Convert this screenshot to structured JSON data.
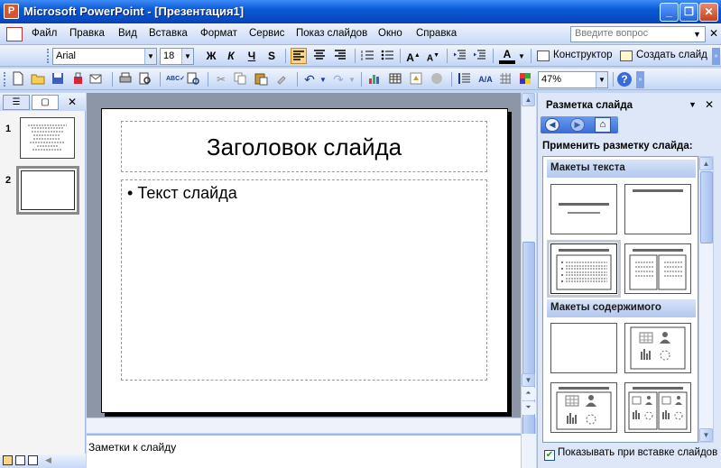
{
  "window": {
    "title": "Microsoft PowerPoint - [Презентация1]",
    "app_icon_letter": "P",
    "controls": {
      "minimize": "_",
      "restore": "❐",
      "close": "✕"
    }
  },
  "menu": {
    "items": [
      "Файл",
      "Правка",
      "Вид",
      "Вставка",
      "Формат",
      "Сервис",
      "Показ слайдов",
      "Окно",
      "Справка"
    ],
    "ask_placeholder": "Введите вопрос"
  },
  "formatting_toolbar": {
    "font": "Arial",
    "size": "18",
    "bold": "Ж",
    "italic": "К",
    "underline": "Ч",
    "shadow": "S",
    "font_color_letter": "A",
    "designer_label": "Конструктор",
    "new_slide_label": "Создать слайд"
  },
  "standard_toolbar": {
    "zoom": "47%",
    "help_icon": "?"
  },
  "outline_pane": {
    "tab_outline_icon": "outline-icon",
    "tab_slides_icon": "slides-icon",
    "close": "✕",
    "thumbnails": [
      {
        "number": "1"
      },
      {
        "number": "2"
      }
    ]
  },
  "slide": {
    "title": "Заголовок слайда",
    "body_bullet": "•",
    "body_text": "Текст слайда"
  },
  "notes": {
    "placeholder": "Заметки к слайду"
  },
  "task_pane": {
    "title": "Разметка слайда",
    "apply_label": "Применить разметку слайда:",
    "sections": [
      "Макеты текста",
      "Макеты содержимого"
    ],
    "show_on_insert": "Показывать при вставке слайдов",
    "show_on_insert_checked": true
  },
  "colors": {
    "titlebar": "#0a5ad6",
    "toolbar": "#c7d8f6",
    "workspace": "#8d96a6",
    "taskpane": "#dde7f8"
  }
}
